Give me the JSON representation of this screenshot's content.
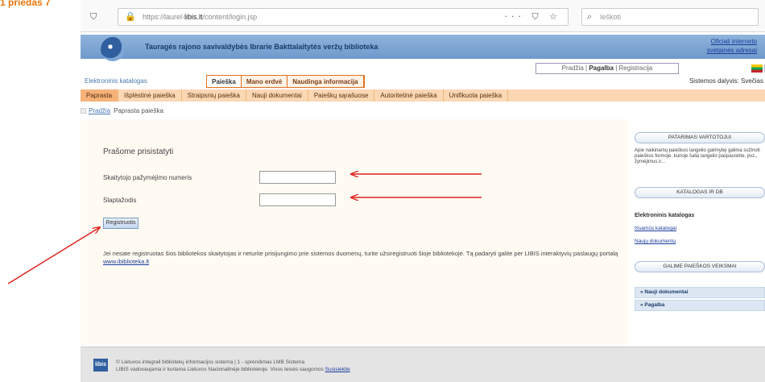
{
  "corner_label": "1 priedas 7",
  "browser": {
    "url_prefix": "https://laurel-",
    "url_domain": "libis.lt",
    "url_suffix": "/content/login.jsp",
    "url_actions": "··· ⛉ ☆",
    "search_placeholder": "Ieškoti"
  },
  "site": {
    "title": "Tauragės rajono savivaldybės Ibrarie Bakttalaitytės veržų biblioteka",
    "header_link_1": "Oficiali interneto",
    "header_link_2": "svetainės adresai",
    "toplinks": {
      "home": "Pradžia",
      "help": "Pagalba",
      "register": "Registracija"
    },
    "catalog_label": "Elektroninis katalogas",
    "tabs": [
      "Paieška",
      "Mano erdvė",
      "Naudinga informacija"
    ],
    "status": "Sistemos dalyvis: Svečias"
  },
  "subnav": [
    "Paprasta",
    "Išplėstinė paieška",
    "Straipsnių paieška",
    "Nauji dokumentai",
    "Paieškų sąrašuose",
    "Autoritetinė paieška",
    "Unifikuota paieška"
  ],
  "breadcrumb": {
    "home": "Pradžia",
    "current": "Paprasta paieška"
  },
  "login": {
    "prompt": "Prašome prisistatyti",
    "reader_label": "Skaitytojo pažymėjimo numeris",
    "password_label": "Slaptažodis",
    "button": "Registruotis",
    "note_text": "Jei nesate registruotas šios bibliotekos skaitytojas ir neturite prisijungimo prie sistemos duomenų, turite užsiregistruoti šioje bibliotekoje. Tą padaryti galite per LIBIS interaktyvių paslaugų portalą",
    "note_link": "www.ibiblioteka.lt"
  },
  "sidebar": {
    "head_1": "PATARIMAS VARTOTOJUI",
    "help_text": "Apie naikinamų paieškos langelio galimybę galima sužinoti paieškos formoje, kurioje šalia langelio paspauskite, pvz., žymėjimus ir...",
    "head_2": "KATALOGAS IR DB",
    "catalog_title": "Elektroninis katalogas",
    "link_1": "Išsamūs katalogai",
    "link_2": "Naujų dokumentų",
    "head_3": "GALIME PAIEŠKOS VEIKSMAI",
    "bar_1": "» Nauji dokumentai",
    "bar_2": "» Pagalba"
  },
  "footer": {
    "logo": "libis",
    "line_1": "© Lietuvos integrali bibliotekų informacijos sistema | 1 - sprendimas LMB Sistema",
    "line_2": "LIBIS vadovaujama ir kuriama Lietuvos Nacionalinėje bibliotekoje. Visos teisės saugomos",
    "line_2_link": "Susisiekite"
  },
  "annotation_color": "#e0201c"
}
